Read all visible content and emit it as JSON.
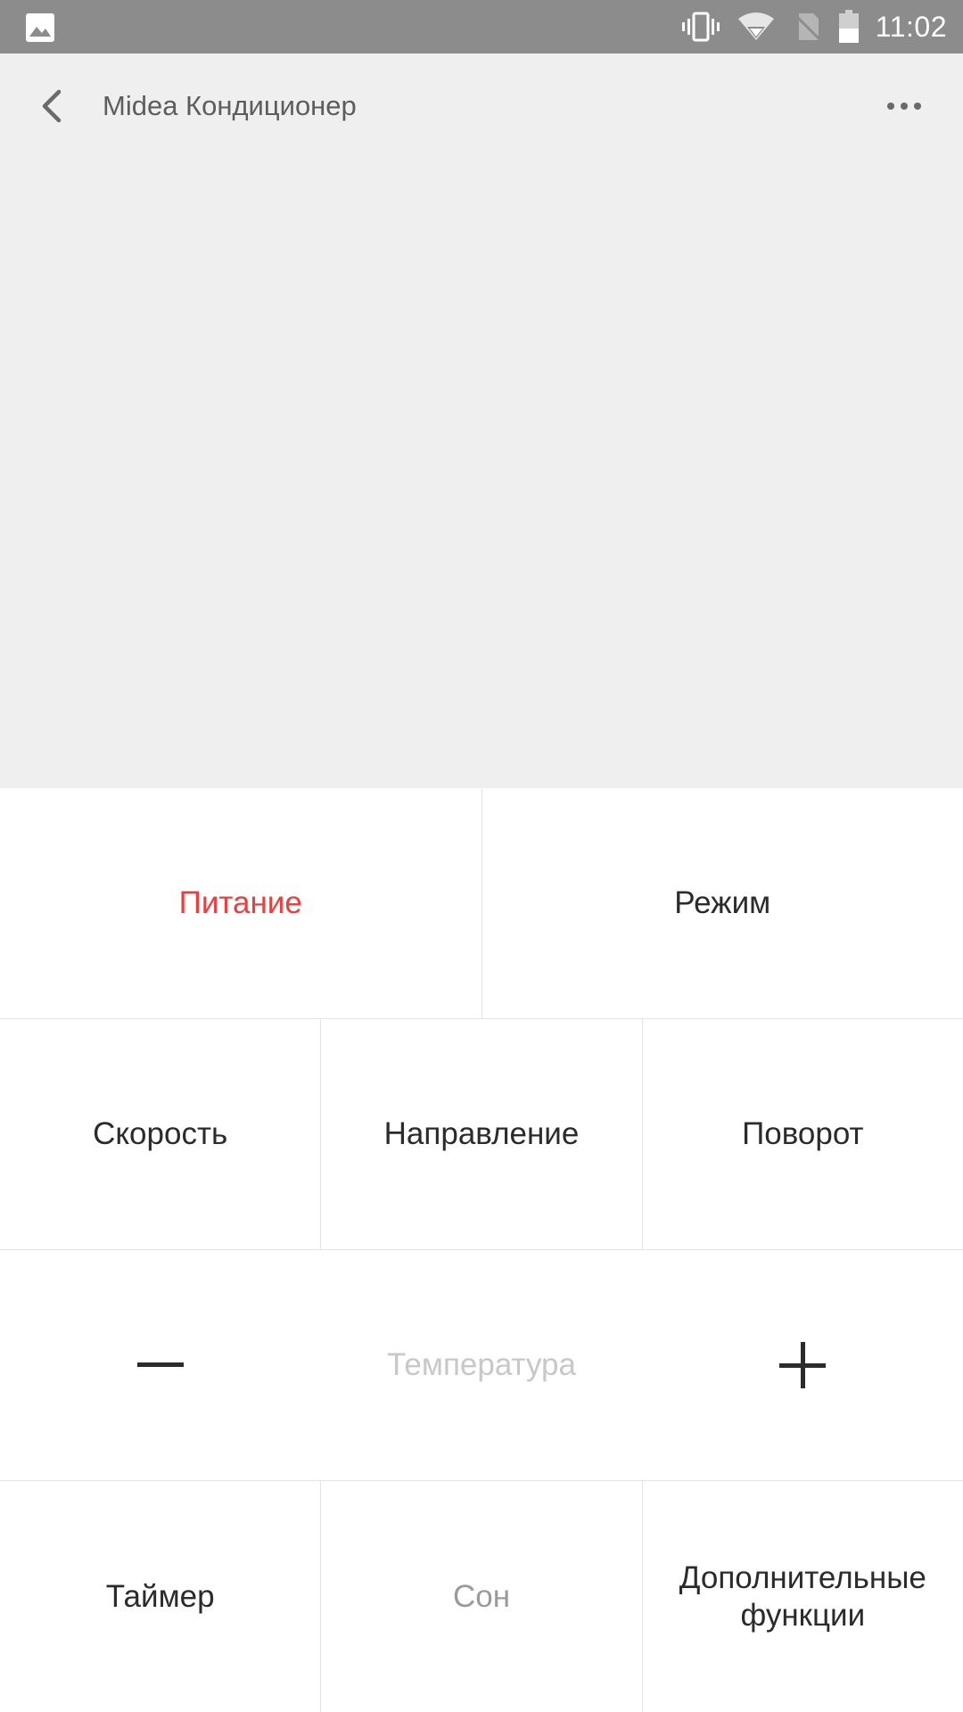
{
  "status_bar": {
    "time": "11:02",
    "icons": [
      "image-icon",
      "vibrate-icon",
      "wifi-icon",
      "no-sim-icon",
      "battery-icon"
    ]
  },
  "header": {
    "title": "Midea Кондиционер",
    "back_icon": "back-arrow-icon",
    "more_icon": "more-dots-icon"
  },
  "controls": {
    "power": "Питание",
    "mode": "Режим",
    "speed": "Скорость",
    "direction": "Направление",
    "swing": "Поворот",
    "temperature": "Температура",
    "timer": "Таймер",
    "sleep": "Сон",
    "extra_line1": "Дополнительные",
    "extra_line2": "функции"
  },
  "colors": {
    "power_active": "#f03c3c",
    "top_background": "#efefef",
    "status_bar": "#8c8c8c"
  }
}
